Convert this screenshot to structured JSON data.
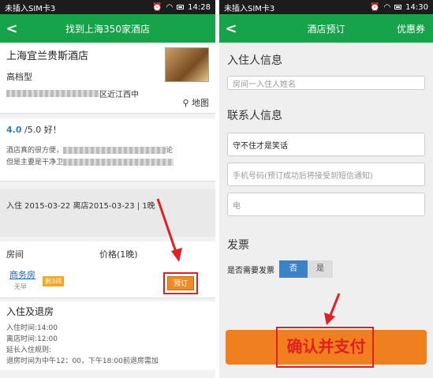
{
  "left": {
    "status": {
      "carrier": "未插入SIM卡3",
      "time": "14:28"
    },
    "header": {
      "title": "找到上海350家酒店"
    },
    "hotel": {
      "name": "上海宜兰贵斯酒店",
      "type": "高档型",
      "address_tail": "区近江西中",
      "map_label": "地图"
    },
    "review": {
      "score": "4.0",
      "score_suffix": "/5.0 好！",
      "line1": "酒店真的很方便，",
      "line1_tail": "论",
      "line2": "但是主要是干净卫"
    },
    "dates": {
      "text": "入住 2015-03-22 离店2015-03-23 | 1晚"
    },
    "rooms": {
      "col_room": "房间",
      "col_price": "价格(1晚)",
      "row": {
        "name": "商务房",
        "breakfast": "无早",
        "remaining": "剩3间",
        "book": "预订"
      }
    },
    "checkin": {
      "heading": "入住及退房",
      "lines": [
        "入住时间:14:00",
        "离店时间:12:00",
        "延长入住规则:",
        "退房时间为中午12：00，下午18:00前退房需加"
      ]
    }
  },
  "right": {
    "status": {
      "carrier": "未插入SIM卡3",
      "time": "14:30"
    },
    "header": {
      "title": "酒店预订",
      "coupon": "优惠券"
    },
    "guest_section": "入住人信息",
    "guest_placeholder": "房间一入住人姓名",
    "contact_section": "联系人信息",
    "contact_name": "守不住才是笑话",
    "phone_placeholder": "手机号码(预订成功后将接受到短信通知)",
    "email_placeholder": "电",
    "invoice_section": "发票",
    "invoice_label": "是否需要发票",
    "invoice_no": "否",
    "invoice_yes": "是",
    "pay_button": "确认并支付"
  },
  "colors": {
    "header_green": "#16a34a",
    "pay_orange": "#f07f1f",
    "highlight_red": "#e02020",
    "toggle_blue": "#3b82c6"
  }
}
